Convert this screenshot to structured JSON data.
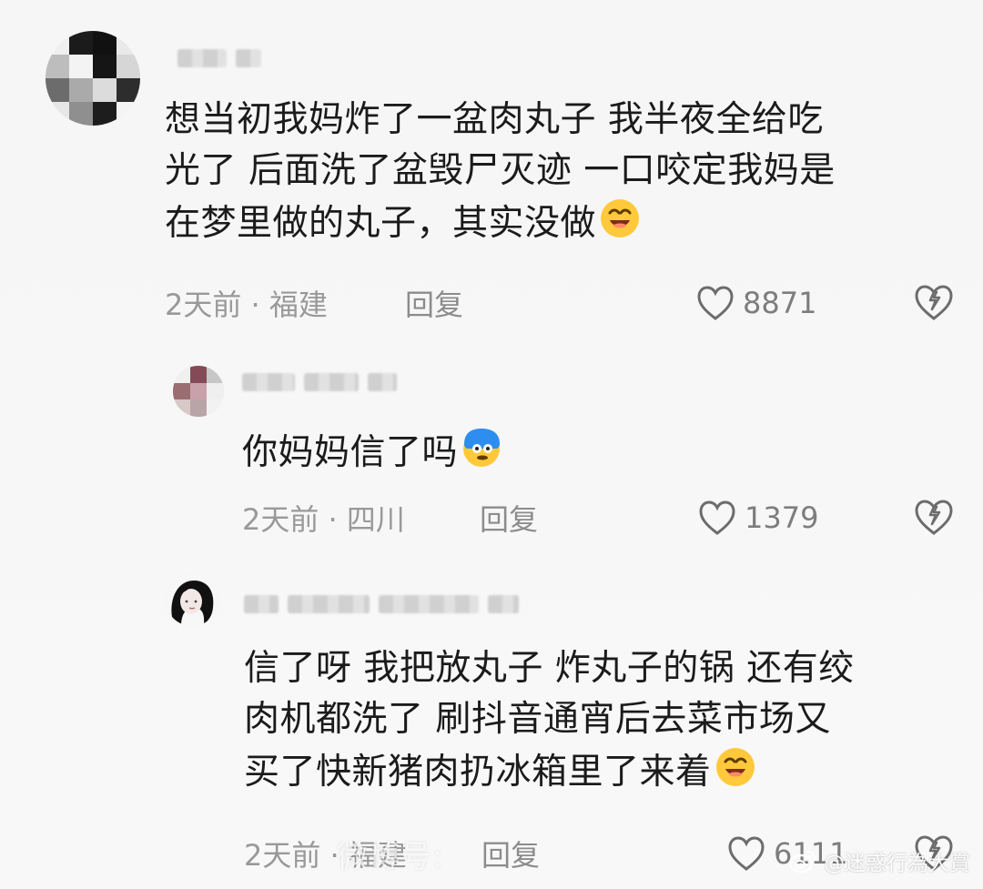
{
  "comments": [
    {
      "text_lines": [
        "想当初我妈炸了一盆肉丸子 我半夜全给吃",
        "光了 后面洗了盆毁尸灭迹 一口咬定我妈是",
        "在梦里做的丸子，其实没做"
      ],
      "emoji": "smile-emoji",
      "time": "2天前",
      "location": "福建",
      "reply_label": "回复",
      "likes": "8871"
    },
    {
      "text_lines": [
        "你妈妈信了吗"
      ],
      "emoji": "shocked-blue-emoji",
      "time": "2天前",
      "location": "四川",
      "reply_label": "回复",
      "likes": "1379"
    },
    {
      "text_lines": [
        "信了呀 我把放丸子 炸丸子的锅 还有绞",
        "肉机都洗了 刷抖音通宵后去菜市场又",
        "买了快新猪肉扔冰箱里了来着"
      ],
      "emoji": "smile-emoji",
      "time": "2天前",
      "location": "福建",
      "reply_label": "回复",
      "likes": "6111"
    }
  ],
  "watermark": {
    "text": "@迷惑行為大賞",
    "center_text": "微博号:"
  },
  "colors": {
    "text": "#1b1b1b",
    "meta": "#999999",
    "background": "#f7f7f7"
  }
}
